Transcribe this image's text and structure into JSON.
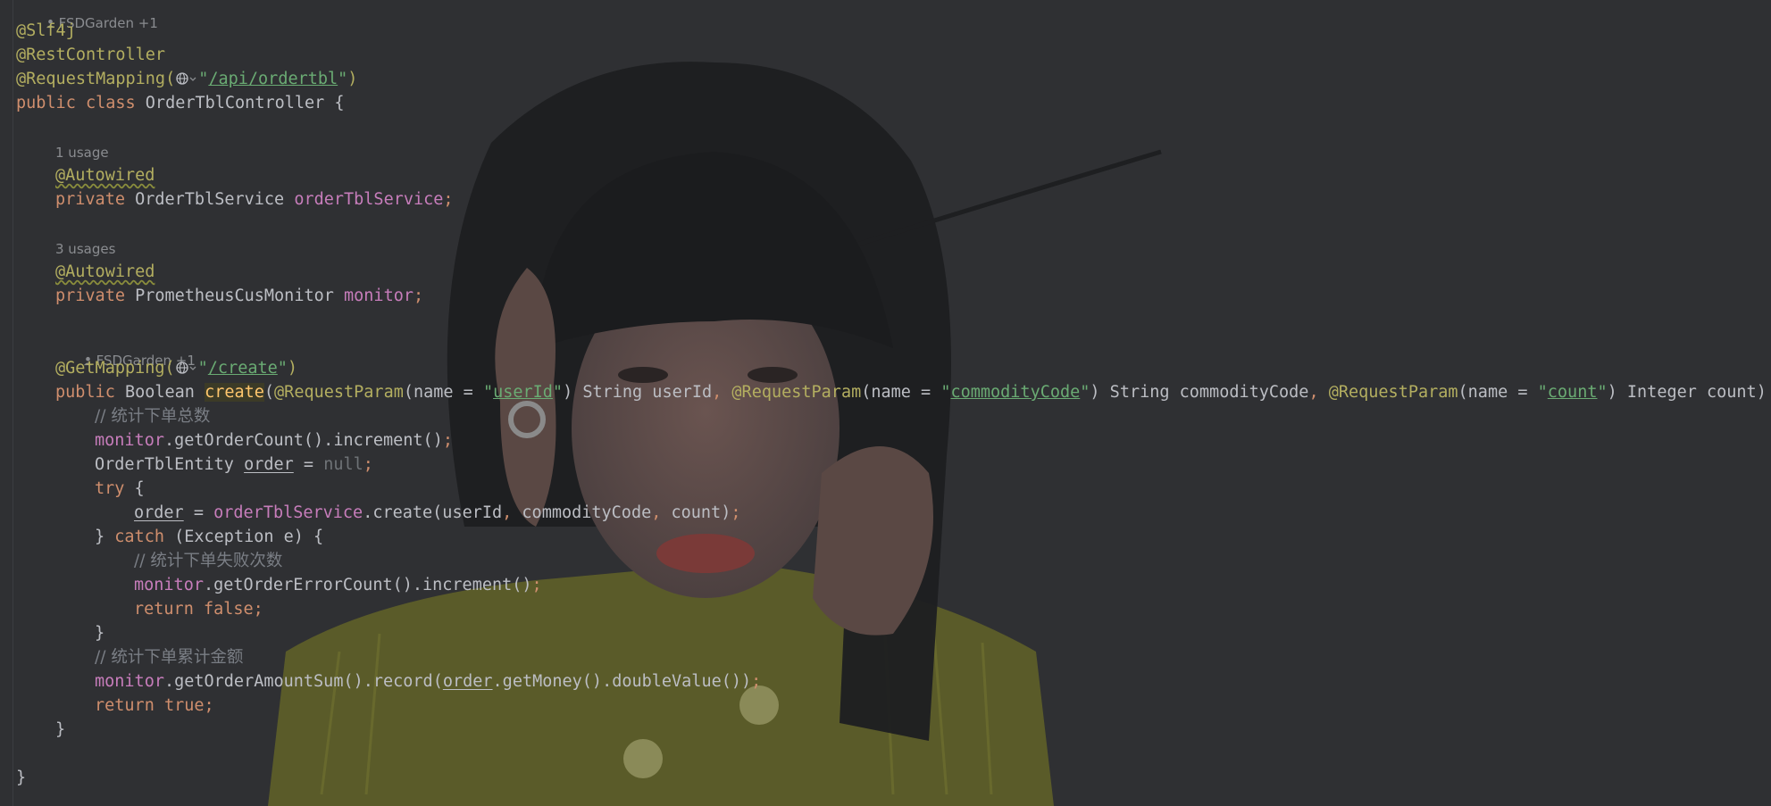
{
  "hints": {
    "authors_top": "FSDGarden +1",
    "usage_service": "1 usage",
    "usage_monitor": "3 usages",
    "authors_method": "FSDGarden +1"
  },
  "code": {
    "l1": "@Slf4j",
    "l2": "@RestController",
    "l3_ann": "@RequestMapping(",
    "l3_str": "/api/ordertbl",
    "l3_end": ")",
    "l4_kw": "public class ",
    "l4_name": "OrderTblController {",
    "l5_ann": "@Autowired",
    "l6_kw": "private ",
    "l6_type": "OrderTblService ",
    "l6_field": "orderTblService",
    "l6_semi": ";",
    "l7_ann": "@Autowired",
    "l8_kw": "private ",
    "l8_type": "PrometheusCusMonitor ",
    "l8_field": "monitor",
    "l8_semi": ";",
    "l9_ann": "@GetMapping(",
    "l9_str": "/create",
    "l9_end": ")",
    "l10_kw": "public ",
    "l10_type": "Boolean ",
    "l10_method": "create",
    "l10_p1": "(",
    "l10_ann1": "@RequestParam",
    "l10_a1": "(name = ",
    "l10_s1": "userId",
    "l10_b1": ") String userId",
    "l10_c1": ", ",
    "l10_ann2": "@RequestParam",
    "l10_a2": "(name = ",
    "l10_s2": "commodityCode",
    "l10_b2": ") String commodityCode",
    "l10_c2": ", ",
    "l10_ann3": "@RequestParam",
    "l10_a3": "(name = ",
    "l10_s3": "count",
    "l10_b3": ") Integer count) {",
    "l11": "// 统计下单总数",
    "l12_f": "monitor",
    "l12_rest": ".getOrderCount().increment()",
    "l12_semi": ";",
    "l13_type": "OrderTblEntity ",
    "l13_var": "order",
    "l13_eq": " = ",
    "l13_null": "null",
    "l13_semi": ";",
    "l14_kw": "try",
    "l14_rest": " {",
    "l15_var": "order",
    "l15_eq": " = ",
    "l15_f": "orderTblService",
    "l15_call": ".create(userId",
    "l15_c1": ", ",
    "l15_a2": "commodityCode",
    "l15_c2": ", ",
    "l15_a3": "count)",
    "l15_semi": ";",
    "l16_a": "} ",
    "l16_kw": "catch",
    "l16_rest": " (Exception e) {",
    "l17": "// 统计下单失败次数",
    "l18_f": "monitor",
    "l18_rest": ".getOrderErrorCount().increment()",
    "l18_semi": ";",
    "l19_kw": "return false",
    "l19_semi": ";",
    "l20": "}",
    "l21": "// 统计下单累计金额",
    "l22_f": "monitor",
    "l22_a": ".getOrderAmountSum().record(",
    "l22_var": "order",
    "l22_b": ".getMoney().doubleValue())",
    "l22_semi": ";",
    "l23_kw": "return true",
    "l23_semi": ";",
    "l24": "}",
    "l25": "}"
  },
  "colors": {
    "background": "#2f3033",
    "annotation": "#b3ae60",
    "keyword": "#cf8e6d",
    "string": "#6aab73",
    "field": "#c77dbb",
    "comment": "#7a7e85",
    "text": "#bcbec4"
  },
  "icons": [
    "person-icon",
    "globe-icon",
    "chevron-down-icon"
  ]
}
